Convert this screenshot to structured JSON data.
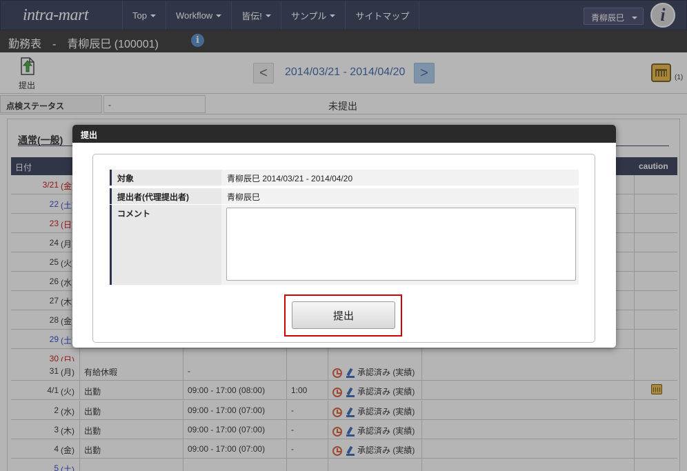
{
  "topnav": {
    "logo": "intra-mart",
    "items": [
      "Top",
      "Workflow",
      "皆伝!",
      "サンプル",
      "サイトマップ"
    ],
    "user_select": "青柳辰巳"
  },
  "titlebar": {
    "title": "勤務表　-　青柳辰巳 (100001)"
  },
  "toolbar": {
    "submit_label": "提出",
    "date_range": "2014/03/21 - 2014/04/20",
    "prev_symbol": "<",
    "next_symbol": ">",
    "caution_count": "(1)"
  },
  "status": {
    "label": "点検ステータス",
    "value": "-",
    "text": "未提出"
  },
  "section": {
    "title": "通常(一般)"
  },
  "table": {
    "headers": {
      "date": "日付",
      "caution": "caution"
    },
    "rows": [
      {
        "date": "3/21",
        "dow": "(金)",
        "color": "red",
        "type": "",
        "time": "",
        "ot": "",
        "status": ""
      },
      {
        "date": "22",
        "dow": "(土)",
        "color": "blue",
        "type": "",
        "time": "",
        "ot": "",
        "status": ""
      },
      {
        "date": "23",
        "dow": "(日)",
        "color": "red",
        "type": "",
        "time": "",
        "ot": "",
        "status": ""
      },
      {
        "date": "24",
        "dow": "(月)",
        "color": "black",
        "type": "",
        "time": "",
        "ot": "",
        "status": ""
      },
      {
        "date": "25",
        "dow": "(火)",
        "color": "black",
        "type": "",
        "time": "",
        "ot": "",
        "status": ""
      },
      {
        "date": "26",
        "dow": "(水)",
        "color": "black",
        "type": "",
        "time": "",
        "ot": "",
        "status": ""
      },
      {
        "date": "27",
        "dow": "(木)",
        "color": "black",
        "type": "",
        "time": "",
        "ot": "",
        "status": ""
      },
      {
        "date": "28",
        "dow": "(金)",
        "color": "black",
        "type": "",
        "time": "",
        "ot": "",
        "status": ""
      },
      {
        "date": "29",
        "dow": "(土)",
        "color": "blue",
        "type": "",
        "time": "",
        "ot": "",
        "status": ""
      },
      {
        "date": "30",
        "dow": "(日)",
        "color": "red",
        "type": "",
        "time": "",
        "ot": "",
        "status": ""
      },
      {
        "date": "31",
        "dow": "(月)",
        "color": "black",
        "type": "有給休暇",
        "time": "-",
        "ot": "",
        "status": "承認済み (実績)"
      },
      {
        "date": "4/1",
        "dow": "(火)",
        "color": "black",
        "type": "出勤",
        "time": "09:00 - 17:00 (08:00)",
        "ot": "1:00",
        "status": "承認済み (実績)",
        "caution": true
      },
      {
        "date": "2",
        "dow": "(水)",
        "color": "black",
        "type": "出勤",
        "time": "09:00 - 17:00 (07:00)",
        "ot": "-",
        "status": "承認済み (実績)"
      },
      {
        "date": "3",
        "dow": "(木)",
        "color": "black",
        "type": "出勤",
        "time": "09:00 - 17:00 (07:00)",
        "ot": "-",
        "status": "承認済み (実績)"
      },
      {
        "date": "4",
        "dow": "(金)",
        "color": "black",
        "type": "出勤",
        "time": "09:00 - 17:00 (07:00)",
        "ot": "-",
        "status": "承認済み (実績)"
      },
      {
        "date": "5",
        "dow": "(土)",
        "color": "blue",
        "type": "",
        "time": "",
        "ot": "",
        "status": ""
      }
    ]
  },
  "modal": {
    "title": "提出",
    "target_label": "対象",
    "target_value": "青柳辰巳 2014/03/21 - 2014/04/20",
    "submitter_label": "提出者(代理提出者)",
    "submitter_value": "青柳辰巳",
    "comment_label": "コメント",
    "comment_value": "",
    "submit_button": "提出"
  },
  "colors": {
    "nav_bg": "#2b3150",
    "title_bg": "#2c2c2c",
    "link_blue": "#2b5ea8",
    "highlight_red": "#d40000",
    "sunday_red": "#c40000",
    "saturday_blue": "#1b38c8"
  }
}
